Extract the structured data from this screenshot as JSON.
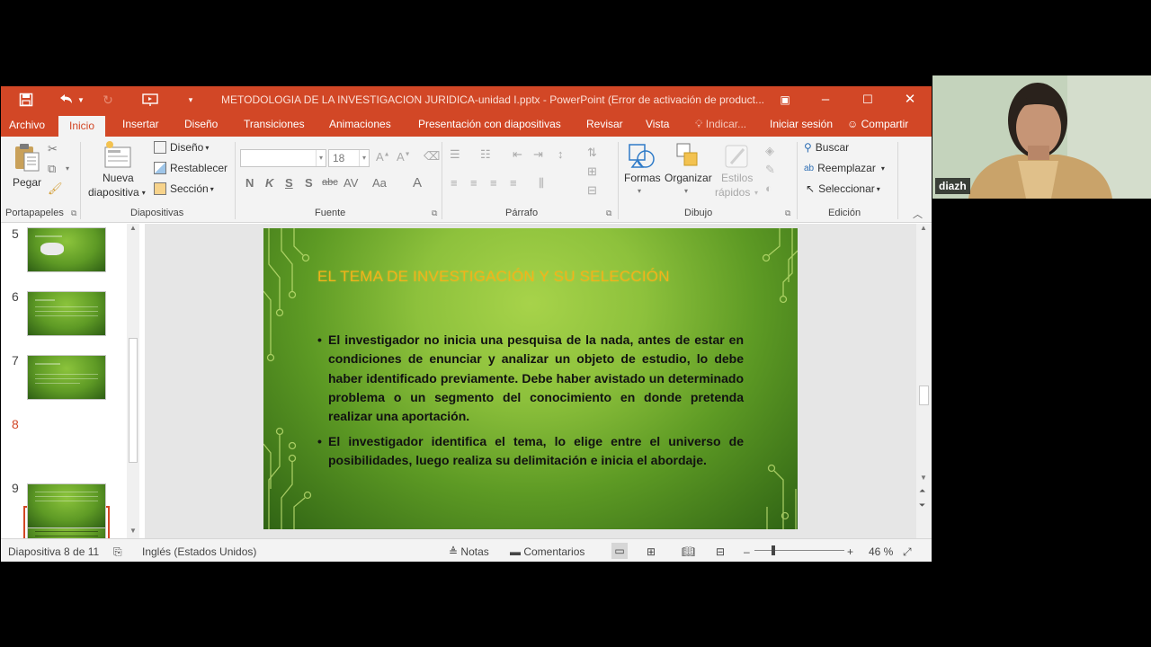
{
  "window": {
    "title": "METODOLOGIA DE LA INVESTIGACION JURIDICA-unidad I.pptx - PowerPoint (Error de activación de product...",
    "colors": {
      "accent": "#d24726",
      "ribbon": "#f3f3f3",
      "slide_title": "#f2b21a"
    }
  },
  "quick_access": {
    "icons": [
      "save-icon",
      "undo-icon",
      "redo-icon",
      "present-icon",
      "customize-icon"
    ]
  },
  "tabs": {
    "archivo": "Archivo",
    "inicio": "Inicio",
    "insertar": "Insertar",
    "diseno": "Diseño",
    "transiciones": "Transiciones",
    "animaciones": "Animaciones",
    "presentacion": "Presentación con diapositivas",
    "revisar": "Revisar",
    "vista": "Vista",
    "indicar": "Indicar...",
    "iniciar_sesion": "Iniciar sesión",
    "compartir": "Compartir"
  },
  "ribbon": {
    "portapapeles": {
      "label": "Portapapeles",
      "pegar": "Pegar"
    },
    "diapositivas": {
      "label": "Diapositivas",
      "nueva_line1": "Nueva",
      "nueva_line2": "diapositiva",
      "diseno": "Diseño",
      "restablecer": "Restablecer",
      "seccion": "Sección"
    },
    "fuente": {
      "label": "Fuente",
      "font_name": "",
      "font_size": "18",
      "format_buttons": [
        "N",
        "K",
        "S",
        "S",
        "abc",
        "AV",
        "Aa",
        "A"
      ]
    },
    "parrafo": {
      "label": "Párrafo"
    },
    "dibujo": {
      "label": "Dibujo",
      "formas": "Formas",
      "organizar": "Organizar",
      "estilos_line1": "Estilos",
      "estilos_line2": "rápidos"
    },
    "edicion": {
      "label": "Edición",
      "buscar": "Buscar",
      "reemplazar": "Reemplazar",
      "seleccionar": "Seleccionar"
    }
  },
  "thumbnails": [
    {
      "number": "5",
      "selected": false
    },
    {
      "number": "6",
      "selected": false
    },
    {
      "number": "7",
      "selected": false
    },
    {
      "number": "8",
      "selected": true
    },
    {
      "number": "9",
      "selected": false
    }
  ],
  "slide": {
    "title": "EL TEMA DE INVESTIGACIÓN Y SU SELECCIÓN",
    "bullets": [
      "El investigador no inicia una pesquisa de la nada, antes de estar en condiciones de enunciar y analizar un objeto de estudio, lo debe haber identificado previamente. Debe haber avistado un determinado problema o un segmento del conocimiento en donde pretenda realizar una aportación.",
      "El investigador identifica el tema, lo elige entre el universo de posibilidades, luego realiza su delimitación e inicia el abordaje."
    ]
  },
  "statusbar": {
    "slide_info": "Diapositiva 8 de 11",
    "language": "Inglés (Estados Unidos)",
    "notas": "Notas",
    "comentarios": "Comentarios",
    "zoom": "46 %",
    "zoom_level": 0.46
  },
  "webcam": {
    "name": "diazh"
  }
}
